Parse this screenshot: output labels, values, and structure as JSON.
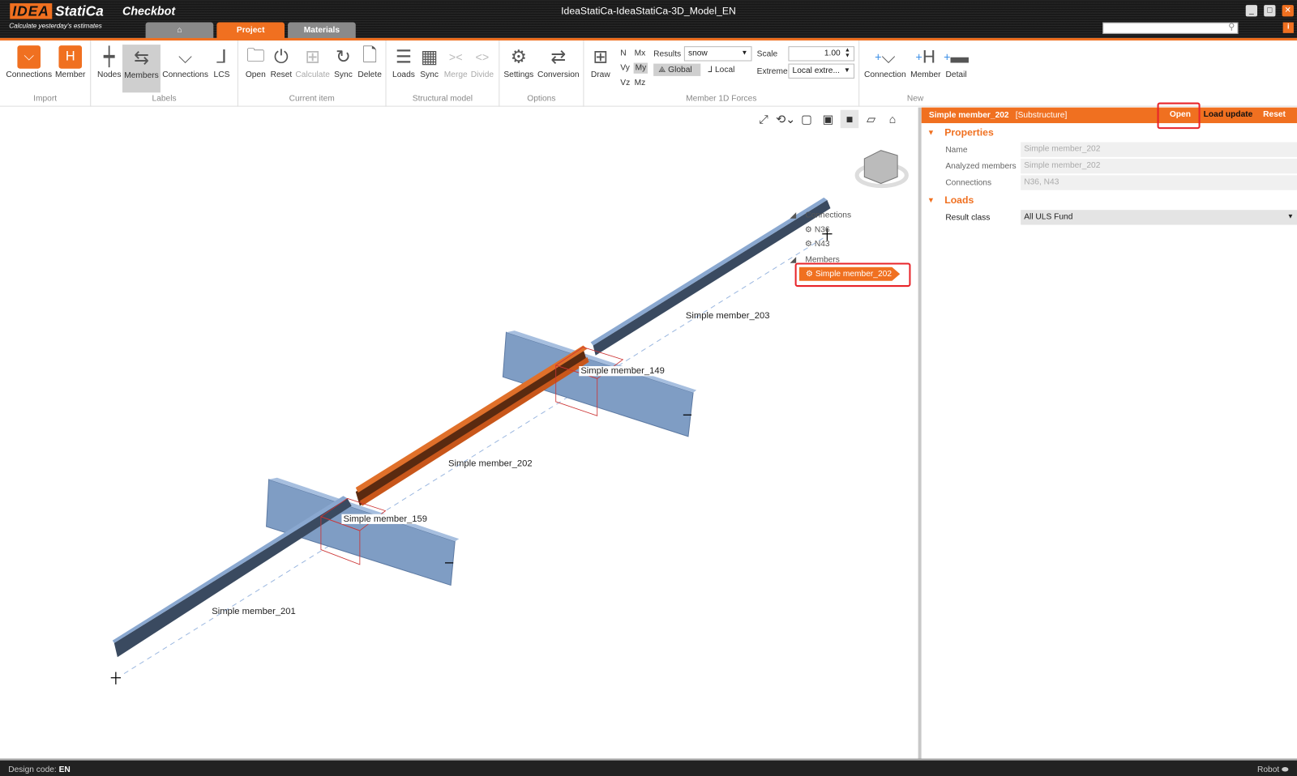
{
  "app": {
    "logo_mark": "IDEA",
    "logo_name": "StatiCa",
    "product": "Checkbot",
    "slogan": "Calculate yesterday's estimates",
    "window_title": "IdeaStatiCa-IdeaStatiCa-3D_Model_EN",
    "info_icon": "i"
  },
  "tabs": [
    {
      "label": "⌂"
    },
    {
      "label": "Project"
    },
    {
      "label": "Materials"
    }
  ],
  "search": {
    "placeholder": ""
  },
  "ribbon": {
    "import": {
      "label": "Import",
      "connections": "Connections",
      "member": "Member"
    },
    "labels": {
      "label": "Labels",
      "nodes": "Nodes",
      "members": "Members",
      "connections": "Connections",
      "lcs": "LCS"
    },
    "current_item": {
      "label": "Current item",
      "open": "Open",
      "reset": "Reset",
      "calculate": "Calculate",
      "sync": "Sync",
      "delete": "Delete"
    },
    "structural_model": {
      "label": "Structural model",
      "loads": "Loads",
      "sync": "Sync",
      "merge": "Merge",
      "divide": "Divide"
    },
    "options": {
      "label": "Options",
      "settings": "Settings",
      "conversion": "Conversion"
    },
    "forces": {
      "label": "Member 1D Forces",
      "draw": "Draw",
      "n": "N",
      "vy": "Vy",
      "vz": "Vz",
      "mx": "Mx",
      "my": "My",
      "mz": "Mz",
      "results_label": "Results",
      "results_value": "snow",
      "global": "Global",
      "local": "Local",
      "scale_label": "Scale",
      "scale_value": "1.00",
      "extreme_label": "Extreme",
      "extreme_value": "Local extre..."
    },
    "new": {
      "label": "New",
      "connection": "Connection",
      "member": "Member",
      "detail": "Detail"
    }
  },
  "tree": {
    "connections": "Connections",
    "n36": "N36",
    "n43": "N43",
    "members": "Members",
    "selected": "Simple member_202"
  },
  "scene": {
    "m203": "Simple member_203",
    "m149": "Simple member_149",
    "m202": "Simple member_202",
    "m159": "Simple member_159",
    "m201": "Simple member_201"
  },
  "panel": {
    "title": "Simple member_202",
    "subtitle": "[Substructure]",
    "open": "Open",
    "load_update": "Load update",
    "reset": "Reset",
    "properties": "Properties",
    "name_label": "Name",
    "name_value": "Simple member_202",
    "analyzed_label": "Analyzed members",
    "analyzed_value": "Simple member_202",
    "connections_label": "Connections",
    "connections_value": "N36, N43",
    "loads": "Loads",
    "result_class_label": "Result class",
    "result_class_value": "All ULS Fund"
  },
  "status": {
    "design_code_label": "Design code:",
    "design_code_value": "EN",
    "robot": "Robot"
  },
  "colors": {
    "accent": "#f07020",
    "steel": "#7f9dc4",
    "selected": "#c8561a"
  }
}
